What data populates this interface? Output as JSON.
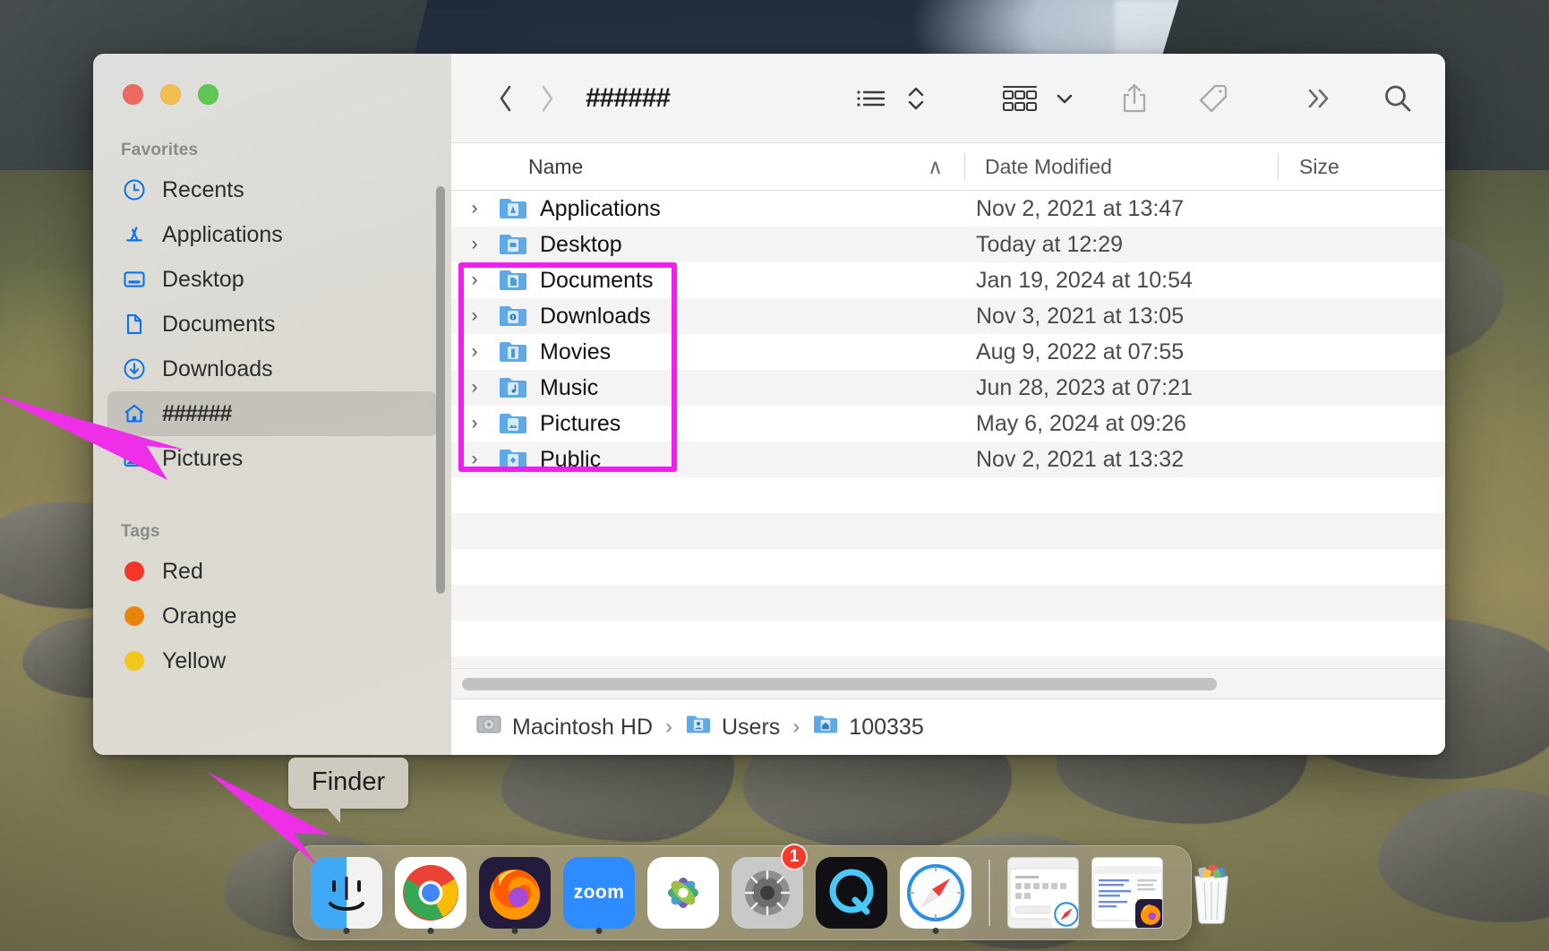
{
  "window": {
    "title": "######",
    "traffic_lights": [
      "close",
      "minimize",
      "zoom"
    ]
  },
  "sidebar": {
    "sections": [
      {
        "heading": "Favorites",
        "items": [
          {
            "label": "Recents",
            "icon": "clock-icon",
            "selected": false
          },
          {
            "label": "Applications",
            "icon": "appstore-icon",
            "selected": false
          },
          {
            "label": "Desktop",
            "icon": "desktop-icon",
            "selected": false
          },
          {
            "label": "Documents",
            "icon": "document-icon",
            "selected": false
          },
          {
            "label": "Downloads",
            "icon": "download-icon",
            "selected": false
          },
          {
            "label": "######",
            "icon": "home-icon",
            "selected": true,
            "redacted": true
          },
          {
            "label": "Pictures",
            "icon": "photo-icon",
            "selected": false
          }
        ]
      },
      {
        "heading": "Tags",
        "items": [
          {
            "label": "Red",
            "icon": "tag-dot-icon",
            "color": "#f5352a"
          },
          {
            "label": "Orange",
            "icon": "tag-dot-icon",
            "color": "#e8860c"
          },
          {
            "label": "Yellow",
            "icon": "tag-dot-icon",
            "color": "#f2c71c"
          }
        ]
      }
    ]
  },
  "toolbar": {
    "back_label": "Back",
    "forward_label": "Forward",
    "view_list_label": "List View",
    "group_label": "Group",
    "share_label": "Share",
    "tags_label": "Tags",
    "more_label": "More",
    "search_label": "Search"
  },
  "columns": {
    "name": "Name",
    "date_modified": "Date Modified",
    "size": "Size",
    "sort_indicator": "∧"
  },
  "files": [
    {
      "name": "Applications",
      "date": "Nov 2, 2021 at 13:47",
      "size": "",
      "icon": "folder-applications"
    },
    {
      "name": "Desktop",
      "date": "Today at 12:29",
      "size": "",
      "icon": "folder-desktop"
    },
    {
      "name": "Documents",
      "date": "Jan 19, 2024 at 10:54",
      "size": "",
      "icon": "folder-documents"
    },
    {
      "name": "Downloads",
      "date": "Nov 3, 2021 at 13:05",
      "size": "",
      "icon": "folder-downloads"
    },
    {
      "name": "Movies",
      "date": "Aug 9, 2022 at 07:55",
      "size": "",
      "icon": "folder-movies"
    },
    {
      "name": "Music",
      "date": "Jun 28, 2023 at 07:21",
      "size": "",
      "icon": "folder-music"
    },
    {
      "name": "Pictures",
      "date": "May 6, 2024 at 09:26",
      "size": "",
      "icon": "folder-pictures"
    },
    {
      "name": "Public",
      "date": "Nov 2, 2021 at 13:32",
      "size": "",
      "icon": "folder-public"
    }
  ],
  "breadcrumb": [
    {
      "label": "Macintosh HD",
      "icon": "harddisk-icon"
    },
    {
      "label": "Users",
      "icon": "folder-users-icon"
    },
    {
      "label": "100335",
      "icon": "folder-home-icon"
    }
  ],
  "breadcrumb_separator": "›",
  "annotations": {
    "highlight_color": "#f01ff0",
    "arrow_color": "#ef2fe8",
    "tooltip": "Finder",
    "highlight_rows": [
      "Desktop",
      "Documents",
      "Downloads",
      "Movies",
      "Music",
      "Pictures"
    ]
  },
  "dock": {
    "items": [
      {
        "label": "Finder",
        "running": true,
        "badge": ""
      },
      {
        "label": "Google Chrome",
        "running": true,
        "badge": ""
      },
      {
        "label": "Firefox",
        "running": true,
        "badge": ""
      },
      {
        "label": "zoom",
        "running": true,
        "badge": ""
      },
      {
        "label": "Photos",
        "running": false,
        "badge": ""
      },
      {
        "label": "System Settings",
        "running": false,
        "badge": "1"
      },
      {
        "label": "QuickTime Player",
        "running": false,
        "badge": ""
      },
      {
        "label": "Safari",
        "running": true,
        "badge": ""
      }
    ],
    "minimized": [
      {
        "label": "Safari Window"
      },
      {
        "label": "Firefox Window"
      }
    ],
    "trash_label": "Trash"
  }
}
